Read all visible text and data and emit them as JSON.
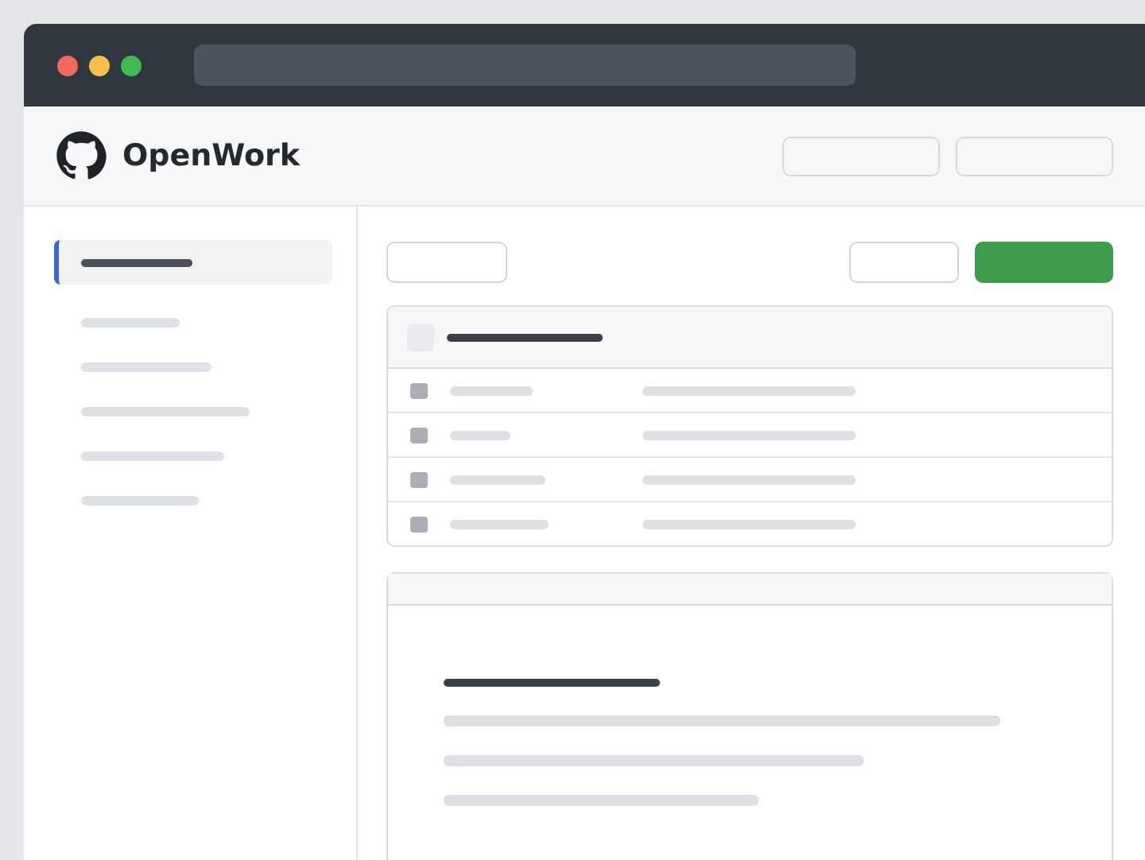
{
  "header": {
    "brand": "OpenWork"
  },
  "table": {
    "select_all": {
      "checked": false
    }
  },
  "sidebar": {
    "items": [
      {
        "selected": true
      },
      {
        "selected": false
      },
      {
        "selected": false
      },
      {
        "selected": false
      },
      {
        "selected": false
      },
      {
        "selected": false
      }
    ]
  }
}
